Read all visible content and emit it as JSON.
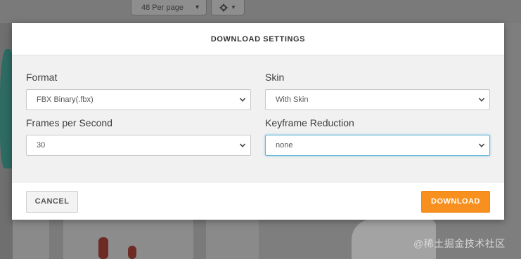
{
  "background": {
    "per_page_value": "48 Per page",
    "watermark": "@稀土掘金技术社区"
  },
  "modal": {
    "title": "DOWNLOAD SETTINGS",
    "format": {
      "label": "Format",
      "value": "FBX Binary(.fbx)"
    },
    "skin": {
      "label": "Skin",
      "value": "With Skin"
    },
    "fps": {
      "label": "Frames per Second",
      "value": "30"
    },
    "keyframe": {
      "label": "Keyframe Reduction",
      "value": "none"
    },
    "cancel_label": "CANCEL",
    "download_label": "DOWNLOAD"
  },
  "colors": {
    "accent": "#f7901e",
    "focus": "#66b8d6"
  },
  "icons": {
    "select_chevron": "chevron-down-icon",
    "settings": "gear-icon"
  }
}
